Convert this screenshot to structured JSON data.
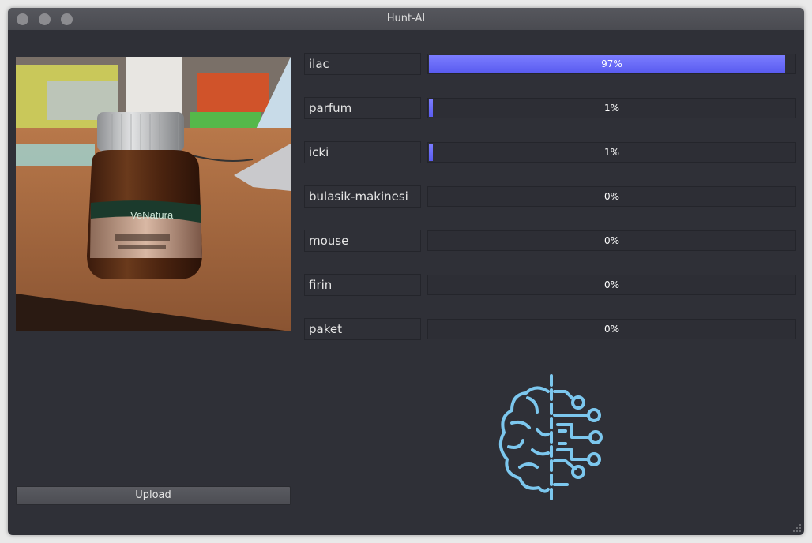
{
  "window": {
    "title": "Hunt-AI",
    "buttons": [
      "close",
      "minimize",
      "maximize"
    ]
  },
  "image": {
    "description_icon": "uploaded-photo",
    "bottle_brand": "VeNatura"
  },
  "predictions": [
    {
      "label": "ilac",
      "value": 0.97,
      "text": "97%"
    },
    {
      "label": "parfum",
      "value": 0.01,
      "text": "1%"
    },
    {
      "label": "icki",
      "value": 0.01,
      "text": "1%"
    },
    {
      "label": "bulasik-makinesi",
      "value": 0.0,
      "text": "0%"
    },
    {
      "label": "mouse",
      "value": 0.0,
      "text": "0%"
    },
    {
      "label": "firin",
      "value": 0.0,
      "text": "0%"
    },
    {
      "label": "paket",
      "value": 0.0,
      "text": "0%"
    }
  ],
  "upload": {
    "label": "Upload"
  },
  "logo": {
    "icon": "ai-brain-icon",
    "color": "#7cc7ee"
  },
  "colors": {
    "accent": "#6b6dfb",
    "background": "#2f3037"
  }
}
